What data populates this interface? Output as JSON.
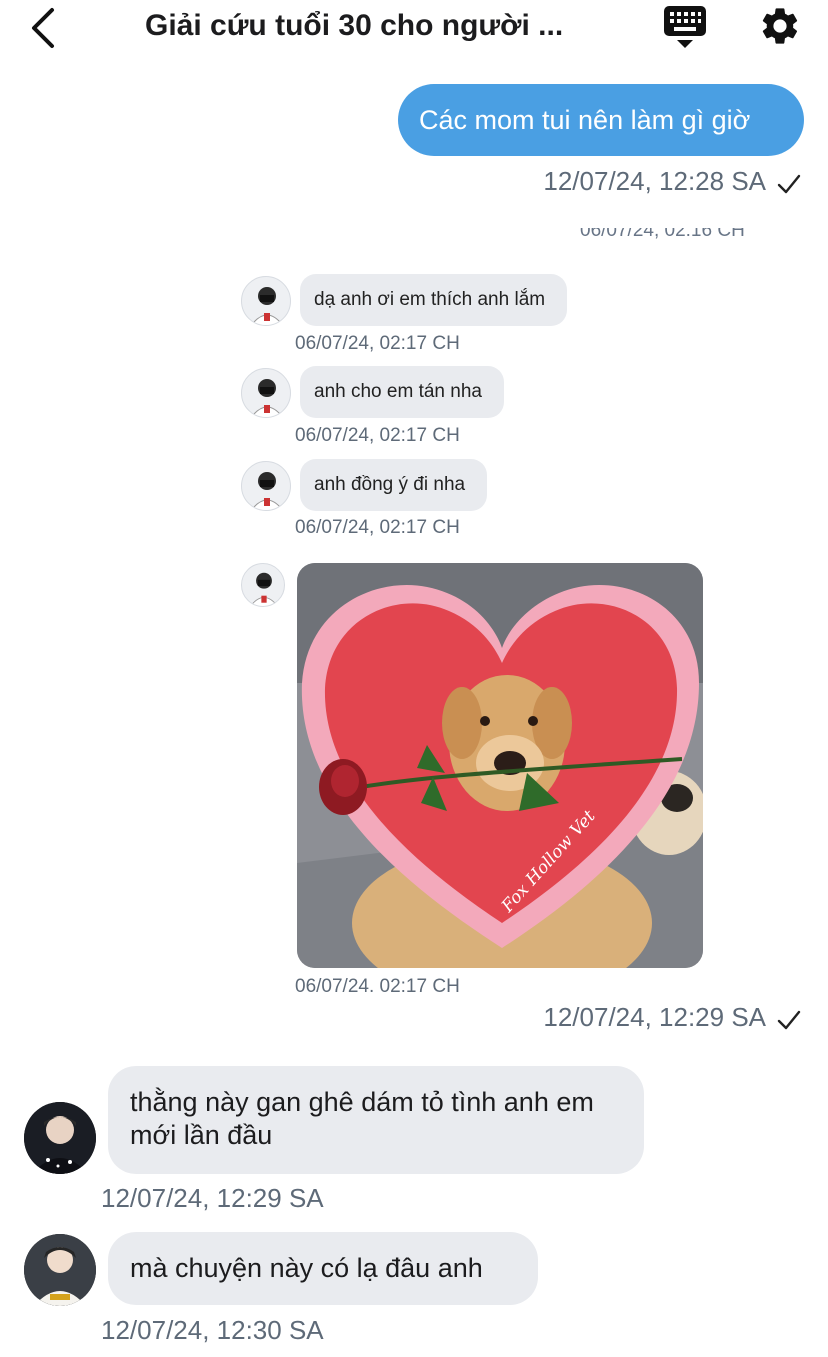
{
  "header": {
    "title": "Giải cứu tuổi 30 cho người ...",
    "back_icon": "chevron-left-icon",
    "keyboard_icon": "keyboard-icon",
    "settings_icon": "gear-icon"
  },
  "colors": {
    "outgoing_bubble": "#4a9fe3",
    "incoming_bubble": "#e9ebef",
    "timestamp": "#5e6a78"
  },
  "messages": {
    "outgoing_1": {
      "text": "Các mom tui nên làm gì giờ",
      "time": "12/07/24, 12:28 SA",
      "status_icon": "checkmark-icon"
    },
    "embedded_screenshot": {
      "cut_off_time": "06/07/24, 02:16 CH",
      "items": [
        {
          "text": "dạ anh ơi em thích anh lắm",
          "time": "06/07/24, 02:17 CH"
        },
        {
          "text": "anh cho em tán nha",
          "time": "06/07/24, 02:17 CH"
        },
        {
          "text": "anh đồng ý đi nha",
          "time": "06/07/24, 02:17 CH"
        }
      ],
      "photo": {
        "description_icon": "dog-with-heart-photo",
        "watermark": "Fox Hollow Vet",
        "time": "06/07/24. 02:17 CH"
      }
    },
    "outgoing_2": {
      "time": "12/07/24, 12:29 SA",
      "status_icon": "checkmark-icon"
    },
    "incoming": [
      {
        "text": "thằng này gan ghê dám tỏ tình anh em mới lần đầu",
        "time": "12/07/24, 12:29 SA"
      },
      {
        "text": "mà chuyện này có lạ đâu anh",
        "time": "12/07/24, 12:30 SA"
      }
    ]
  }
}
